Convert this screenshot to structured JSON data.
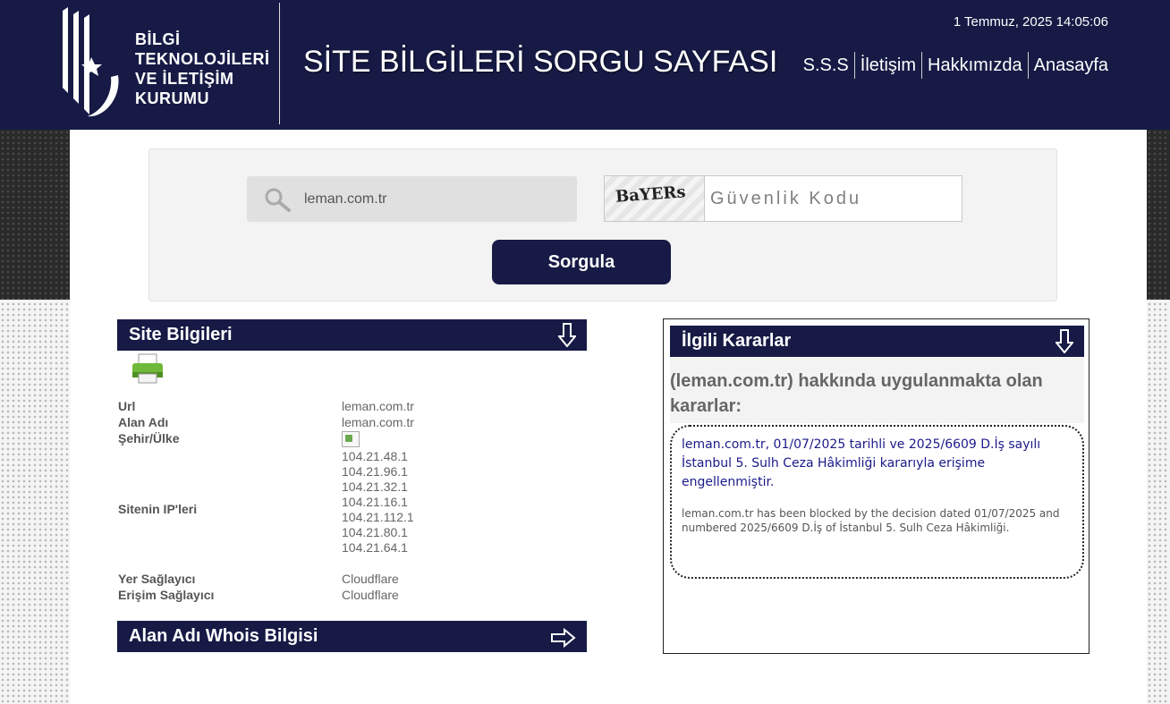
{
  "header": {
    "logo_lines": [
      "BİLGİ",
      "TEKNOLOJİLERİ",
      "VE İLETİŞİM",
      "KURUMU"
    ],
    "title": "SİTE BİLGİLERİ SORGU SAYFASI",
    "datetime": "1 Temmuz, 2025 14:05:06",
    "nav": [
      "S.S.S",
      "İletişim",
      "Hakkımızda",
      "Anasayfa"
    ]
  },
  "search": {
    "value": "leman.com.tr",
    "captcha_text": "BaYERs",
    "captcha_placeholder": "Güvenlik Kodu",
    "submit_label": "Sorgula"
  },
  "site_info": {
    "title": "Site Bilgileri",
    "rows": {
      "url": {
        "label": "Url",
        "value": "leman.com.tr"
      },
      "domain": {
        "label": "Alan Adı",
        "value": "leman.com.tr"
      },
      "city": {
        "label": "Şehir/Ülke"
      },
      "ips": {
        "label": "Sitenin IP'leri",
        "values": [
          "104.21.48.1",
          "104.21.96.1",
          "104.21.32.1",
          "104.21.16.1",
          "104.21.112.1",
          "104.21.80.1",
          "104.21.64.1"
        ]
      },
      "host": {
        "label": "Yer Sağlayıcı",
        "value": "Cloudflare"
      },
      "access": {
        "label": "Erişim Sağlayıcı",
        "value": "Cloudflare"
      }
    }
  },
  "whois": {
    "title": "Alan Adı Whois Bilgisi"
  },
  "decisions": {
    "title": "İlgili Kararlar",
    "heading": "(leman.com.tr) hakkında uygulanmakta olan kararlar:",
    "text_tr": "leman.com.tr, 01/07/2025 tarihli ve 2025/6609 D.İş sayılı İstanbul 5. Sulh Ceza Hâkimliği kararıyla erişime engellenmiştir.",
    "text_en": "leman.com.tr has been blocked by the decision dated 01/07/2025 and numbered 2025/6609 D.İş of İstanbul 5. Sulh Ceza Hâkimliği."
  },
  "colors": {
    "brand_navy": "#161a45",
    "decision_text": "#1a1a8a"
  }
}
